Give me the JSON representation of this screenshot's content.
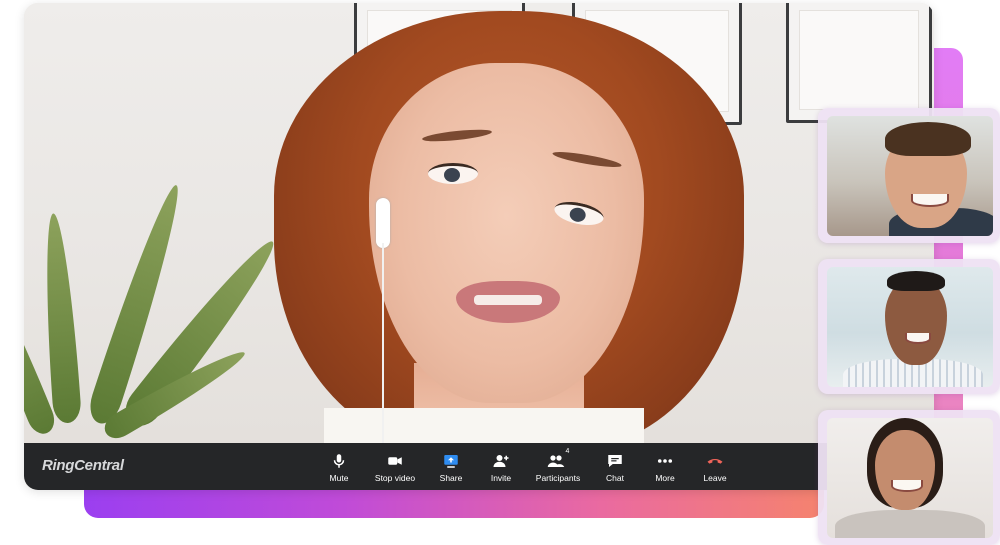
{
  "brand": {
    "name": "RingCentral"
  },
  "toolbar": {
    "controls": [
      {
        "id": "mute",
        "label": "Mute",
        "icon": "microphone-icon"
      },
      {
        "id": "stop-video",
        "label": "Stop video",
        "icon": "video-camera-icon"
      },
      {
        "id": "share",
        "label": "Share",
        "icon": "share-screen-icon"
      },
      {
        "id": "invite",
        "label": "Invite",
        "icon": "add-person-icon"
      },
      {
        "id": "participants",
        "label": "Participants",
        "icon": "participants-icon",
        "count": "4"
      },
      {
        "id": "chat",
        "label": "Chat",
        "icon": "chat-bubble-icon"
      },
      {
        "id": "more",
        "label": "More",
        "icon": "more-dots-icon"
      },
      {
        "id": "leave",
        "label": "Leave",
        "icon": "hang-up-icon",
        "color": "#f0645a"
      }
    ]
  },
  "colors": {
    "toolbar_bg": "#252628",
    "share_accent": "#2f8cf0",
    "gradient_start": "#9b3ff0",
    "gradient_end": "#f5836e"
  },
  "participants_side": [
    {
      "id": "participant-1"
    },
    {
      "id": "participant-2"
    },
    {
      "id": "participant-3"
    }
  ]
}
